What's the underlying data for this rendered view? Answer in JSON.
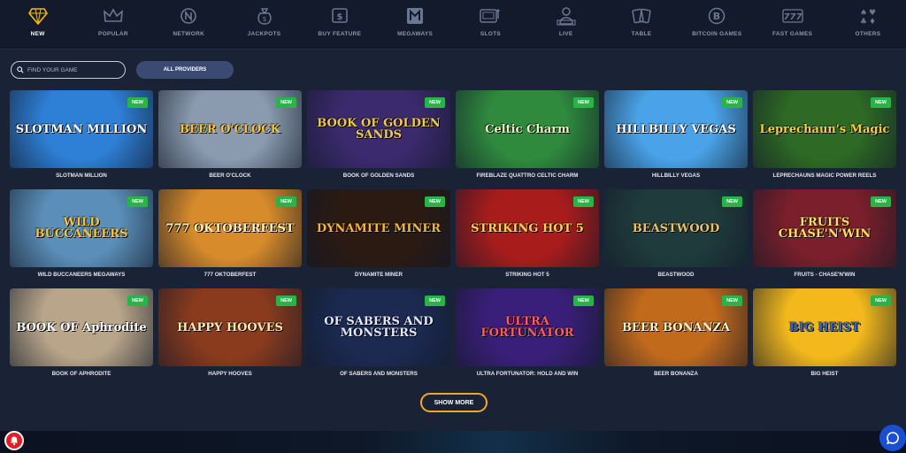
{
  "nav": {
    "categories": [
      {
        "label": "NEW",
        "icon": "diamond-icon"
      },
      {
        "label": "POPULAR",
        "icon": "crown-icon"
      },
      {
        "label": "NETWORK",
        "icon": "network-icon"
      },
      {
        "label": "JACKPOTS",
        "icon": "money-bag-icon"
      },
      {
        "label": "BUY FEATURE",
        "icon": "dollar-box-icon"
      },
      {
        "label": "MEGAWAYS",
        "icon": "megaways-icon"
      },
      {
        "label": "SLOTS",
        "icon": "slot-machine-icon"
      },
      {
        "label": "LIVE",
        "icon": "live-dealer-icon"
      },
      {
        "label": "TABLE",
        "icon": "cards-icon"
      },
      {
        "label": "BITCOIN GAMES",
        "icon": "bitcoin-icon"
      },
      {
        "label": "FAST GAMES",
        "icon": "sevens-icon"
      },
      {
        "label": "OTHERS",
        "icon": "suits-icon"
      }
    ],
    "active": "NEW",
    "active_color": "#f5b80f"
  },
  "search": {
    "placeholder": "FIND YOUR GAME"
  },
  "providers_button": "ALL PROVIDERS",
  "badge_label": "NEW",
  "games": [
    {
      "title": "SLOTMAN MILLION",
      "art": "SLOTMAN MILLION",
      "bg": "#2e7fd6",
      "fg": "#ffffff"
    },
    {
      "title": "BEER O'CLOCK",
      "art": "BEER O'CLOCK",
      "bg": "#8a9bb0",
      "fg": "#f7c534"
    },
    {
      "title": "BOOK OF GOLDEN SANDS",
      "art": "BOOK OF GOLDEN SANDS",
      "bg": "#3b2a6e",
      "fg": "#f2c94c"
    },
    {
      "title": "FIREBLAZE QUATTRO CELTIC CHARM",
      "art": "Celtic Charm",
      "bg": "#2f8a3e",
      "fg": "#e9f7c0"
    },
    {
      "title": "HILLBILLY VEGAS",
      "art": "HILLBILLY VEGAS",
      "bg": "#4aa3e8",
      "fg": "#ffffff"
    },
    {
      "title": "LEPRECHAUNS MAGIC POWER REELS",
      "art": "Leprechaun's Magic",
      "bg": "#2e6a25",
      "fg": "#f4d03f"
    },
    {
      "title": "WILD BUCCANEERS MEGAWAYS",
      "art": "WILD BUCCANEERS",
      "bg": "#5b8fb9",
      "fg": "#f5c542"
    },
    {
      "title": "777 OKTOBERFEST",
      "art": "777 OKTOBERFEST",
      "bg": "#d88b2a",
      "fg": "#fff2c2"
    },
    {
      "title": "DYNAMITE MINER",
      "art": "DYNAMITE MINER",
      "bg": "#2b1a12",
      "fg": "#f5b63a"
    },
    {
      "title": "STRIKING HOT 5",
      "art": "STRIKING HOT 5",
      "bg": "#a81c1c",
      "fg": "#ffd24a"
    },
    {
      "title": "BEASTWOOD",
      "art": "BEASTWOOD",
      "bg": "#1f3b3c",
      "fg": "#e8c26a"
    },
    {
      "title": "FRUITS - CHASE'N'WIN",
      "art": "FRUITS CHASE'N'WIN",
      "bg": "#7a1f2b",
      "fg": "#ffe066"
    },
    {
      "title": "BOOK OF APHRODITE",
      "art": "BOOK OF Aphrodite",
      "bg": "#b9a68a",
      "fg": "#ffffff"
    },
    {
      "title": "HAPPY HOOVES",
      "art": "HAPPY HOOVES",
      "bg": "#8a3b1e",
      "fg": "#ffe9b0"
    },
    {
      "title": "OF SABERS AND MONSTERS",
      "art": "OF SABERS AND MONSTERS",
      "bg": "#1c2a52",
      "fg": "#dfe8ff"
    },
    {
      "title": "ULTRA FORTUNATOR: HOLD AND WIN",
      "art": "ULTRA FORTUNATOR",
      "bg": "#3a1f7a",
      "fg": "#ff5b5b"
    },
    {
      "title": "BEER BONANZA",
      "art": "BEER BONANZA",
      "bg": "#c26a1c",
      "fg": "#fff3c4"
    },
    {
      "title": "BIG HEIST",
      "art": "BIG HEIST",
      "bg": "#f2b81c",
      "fg": "#2a66d9"
    }
  ],
  "show_more": "SHOW MORE"
}
